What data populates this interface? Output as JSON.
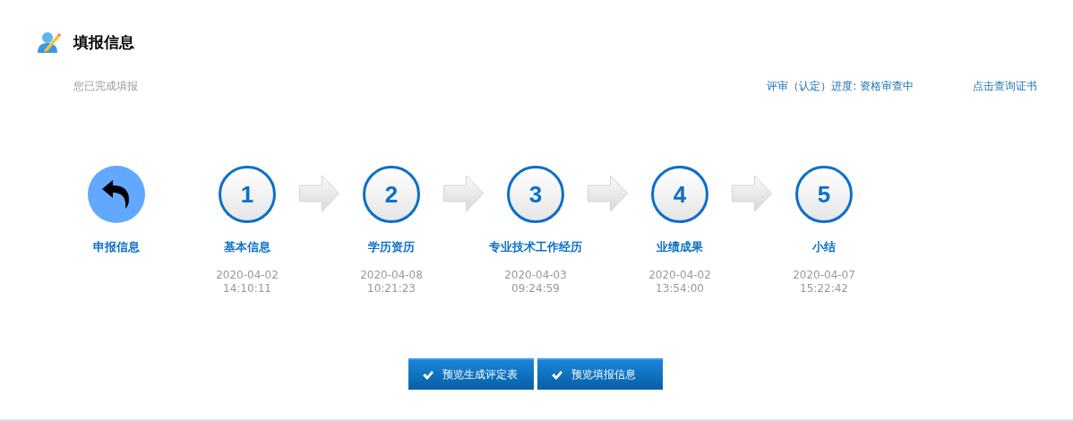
{
  "header": {
    "title": "填报信息",
    "status": "您已完成填报",
    "progress_label": "评审（认定）进度:",
    "progress_value": "资格审查中",
    "certificate_link": "点击查询证书"
  },
  "steps": [
    {
      "kind": "back",
      "label": "申报信息"
    },
    {
      "kind": "numbered",
      "number": "1",
      "label": "基本信息",
      "date": "2020-04-02",
      "time": "14:10:11"
    },
    {
      "kind": "numbered",
      "number": "2",
      "label": "学历资历",
      "date": "2020-04-08",
      "time": "10:21:23"
    },
    {
      "kind": "numbered",
      "number": "3",
      "label": "专业技术工作经历",
      "date": "2020-04-03",
      "time": "09:24:59"
    },
    {
      "kind": "numbered",
      "number": "4",
      "label": "业绩成果",
      "date": "2020-04-02",
      "time": "13:54:00"
    },
    {
      "kind": "numbered",
      "number": "5",
      "label": "小结",
      "date": "2020-04-07",
      "time": "15:22:42"
    }
  ],
  "buttons": [
    "预览生成评定表",
    "预览填报信息"
  ]
}
